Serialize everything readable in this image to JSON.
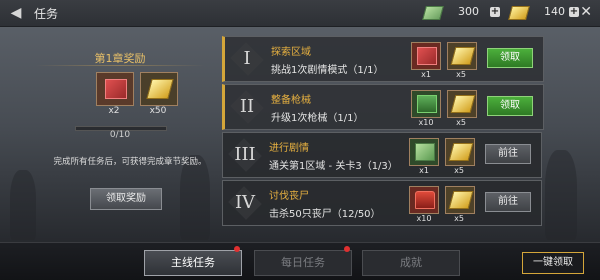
{
  "header": {
    "title": "任务",
    "cash": "300",
    "gold": "140"
  },
  "chapter": {
    "title": "第1章奖励",
    "rewards": [
      {
        "icon": "ticket-icon",
        "count": "x2"
      },
      {
        "icon": "gold-bar-icon",
        "count": "x50"
      }
    ],
    "progress": "0/10",
    "progress_fraction": 0,
    "description": "完成所有任务后，可获得完成章节奖励。",
    "claim_label": "领取奖励"
  },
  "tasks": [
    {
      "numeral": "I",
      "name": "探索区域",
      "desc": "挑战1次剧情模式（1/1）",
      "rewards": [
        {
          "icon": "ticket-icon",
          "count": "x1"
        },
        {
          "icon": "gold-bar-icon",
          "count": "x5"
        }
      ],
      "action": "领取"
    },
    {
      "numeral": "II",
      "name": "整备枪械",
      "desc": "升级1次枪械（1/1）",
      "rewards": [
        {
          "icon": "ammo-crate-icon",
          "count": "x10"
        },
        {
          "icon": "gold-bar-icon",
          "count": "x5"
        }
      ],
      "action": "领取"
    },
    {
      "numeral": "III",
      "name": "进行剧情",
      "desc": "通关第1区域 - 关卡3（1/3）",
      "rewards": [
        {
          "icon": "cash-icon",
          "count": "x1"
        },
        {
          "icon": "gold-bar-icon",
          "count": "x5"
        }
      ],
      "action": "前往"
    },
    {
      "numeral": "IV",
      "name": "讨伐丧尸",
      "desc": "击杀50只丧尸（12/50）",
      "rewards": [
        {
          "icon": "fire-extinguisher-icon",
          "count": "x10"
        },
        {
          "icon": "gold-bar-icon",
          "count": "x5"
        }
      ],
      "action": "前往"
    }
  ],
  "tabs": [
    {
      "label": "主线任务"
    },
    {
      "label": "每日任务"
    },
    {
      "label": "成就"
    }
  ],
  "one_key_label": "一键领取"
}
